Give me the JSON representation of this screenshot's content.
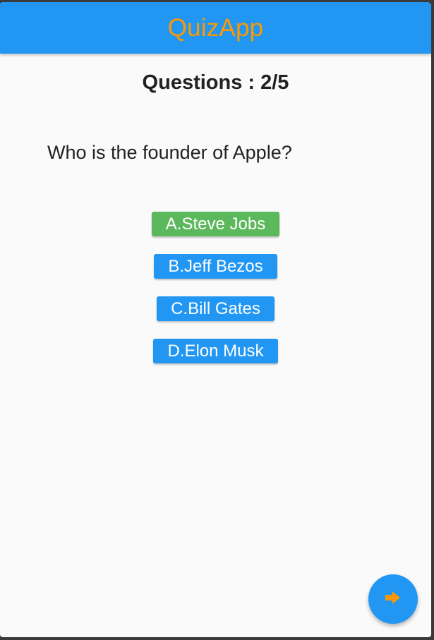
{
  "app": {
    "title": "QuizApp"
  },
  "quiz": {
    "counter": "Questions : 2/5",
    "question": "Who is the founder of Apple?",
    "options": [
      {
        "label": "A.Steve Jobs",
        "state": "correct"
      },
      {
        "label": "B.Jeff Bezos",
        "state": "default"
      },
      {
        "label": "C.Bill Gates",
        "state": "default"
      },
      {
        "label": "D.Elon Musk",
        "state": "default"
      }
    ]
  },
  "fab": {
    "icon": "arrow-right-icon"
  },
  "colors": {
    "primary": "#2196f3",
    "accent": "#ff9800",
    "correct": "#5cb85c",
    "background": "#fafafa"
  }
}
